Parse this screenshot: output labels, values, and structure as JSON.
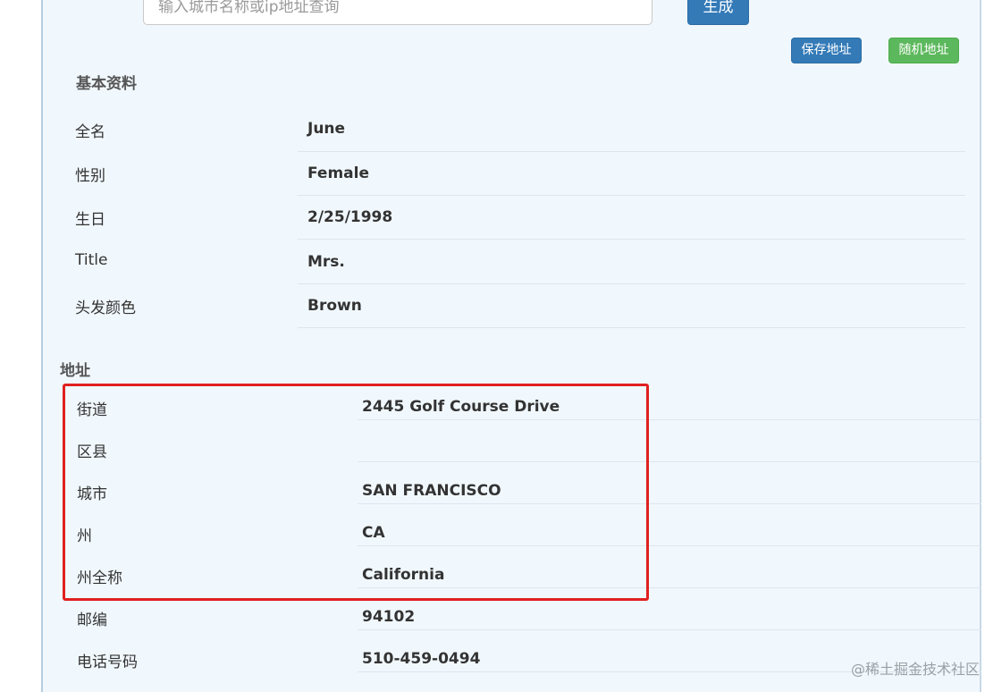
{
  "search": {
    "placeholder": "输入城市名称或ip地址查询",
    "generate_label": "生成"
  },
  "actions": {
    "save_label": "保存地址",
    "random_label": "随机地址"
  },
  "basic": {
    "title": "基本资料",
    "rows": [
      {
        "label": "全名",
        "value": "June"
      },
      {
        "label": "性别",
        "value": "Female"
      },
      {
        "label": "生日",
        "value": "2/25/1998"
      },
      {
        "label": "Title",
        "value": "Mrs."
      },
      {
        "label": "头发颜色",
        "value": "Brown"
      }
    ]
  },
  "address": {
    "title": "地址",
    "rows": [
      {
        "label": "街道",
        "value": "2445  Golf Course Drive"
      },
      {
        "label": "区县",
        "value": ""
      },
      {
        "label": "城市",
        "value": "SAN FRANCISCO"
      },
      {
        "label": "州",
        "value": "CA"
      },
      {
        "label": "州全称",
        "value": "California"
      },
      {
        "label": "邮编",
        "value": "94102"
      },
      {
        "label": "电话号码",
        "value": "510-459-0494"
      }
    ]
  },
  "watermark": "@稀土掘金技术社区",
  "colors": {
    "primary": "#337ab7",
    "success": "#5cb85c",
    "highlight": "#e02020",
    "panel_bg": "#f1f8fd"
  }
}
